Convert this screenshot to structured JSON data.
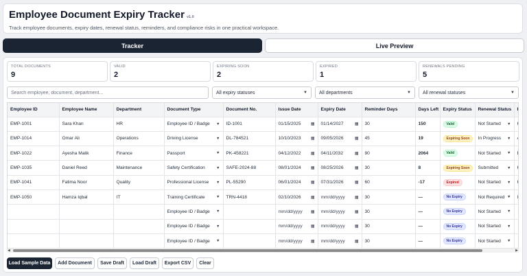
{
  "header": {
    "title": "Employee Document Expiry Tracker",
    "version": "v1.0",
    "subtitle": "Track employee documents, expiry dates, renewal status, reminders, and compliance risks in one practical workspace."
  },
  "tabs": [
    {
      "label": "Tracker",
      "active": true
    },
    {
      "label": "Live Preview",
      "active": false
    }
  ],
  "stats": [
    {
      "label": "TOTAL DOCUMENTS",
      "value": "9"
    },
    {
      "label": "VALID",
      "value": "2"
    },
    {
      "label": "EXPIRING SOON",
      "value": "2"
    },
    {
      "label": "EXPIRED",
      "value": "1"
    },
    {
      "label": "RENEWALS PENDING",
      "value": "5"
    }
  ],
  "filters": {
    "search_placeholder": "Search employee, document, department...",
    "expiry_status": "All expiry statuses",
    "departments": "All departments",
    "renewal_status": "All renewal statuses"
  },
  "table": {
    "columns": [
      "Employee ID",
      "Employee Name",
      "Department",
      "Document Type",
      "Document No.",
      "Issue Date",
      "Expiry Date",
      "Reminder Days",
      "Days Left",
      "Expiry Status",
      "Renewal Status",
      "R"
    ],
    "rows": [
      {
        "id": "EMP-1001",
        "name": "Sara Khan",
        "dept": "HR",
        "doc_type": "Employee ID / Badge",
        "doc_no": "ID-1001",
        "issue": "01/15/2025",
        "expiry": "01/14/2027",
        "reminder": "30",
        "days_left": "150",
        "status": "Valid",
        "renewal": "Not Started",
        "extra": "H"
      },
      {
        "id": "EMP-1014",
        "name": "Omar Ali",
        "dept": "Operations",
        "doc_type": "Driving License",
        "doc_no": "DL-784521",
        "issue": "10/10/2023",
        "expiry": "09/05/2026",
        "reminder": "45",
        "days_left": "19",
        "status": "Expiring Soon",
        "renewal": "In Progress",
        "extra": "A"
      },
      {
        "id": "EMP-1022",
        "name": "Ayesha Malik",
        "dept": "Finance",
        "doc_type": "Passport",
        "doc_no": "PK-458221",
        "issue": "04/12/2022",
        "expiry": "04/11/2032",
        "reminder": "90",
        "days_left": "2064",
        "status": "Valid",
        "renewal": "Not Started",
        "extra": "E"
      },
      {
        "id": "EMP-1035",
        "name": "Daniel Reed",
        "dept": "Maintenance",
        "doc_type": "Safety Certification",
        "doc_no": "SAFE-2024-88",
        "issue": "08/01/2024",
        "expiry": "08/25/2026",
        "reminder": "30",
        "days_left": "8",
        "status": "Expiring Soon",
        "renewal": "Submitted",
        "extra": "H"
      },
      {
        "id": "EMP-1041",
        "name": "Fatima Noor",
        "dept": "Quality",
        "doc_type": "Professional License",
        "doc_no": "PL-55290",
        "issue": "06/01/2024",
        "expiry": "07/31/2026",
        "reminder": "60",
        "days_left": "-17",
        "status": "Expired",
        "renewal": "Not Started",
        "extra": "H"
      },
      {
        "id": "EMP-1050",
        "name": "Hamza Iqbal",
        "dept": "IT",
        "doc_type": "Training Certificate",
        "doc_no": "TRN-4418",
        "issue": "02/10/2026",
        "expiry": "mm/dd/yyyy",
        "reminder": "30",
        "days_left": "—",
        "status": "No Expiry",
        "renewal": "Not Required",
        "extra": "IT"
      },
      {
        "id": "",
        "name": "",
        "dept": "",
        "doc_type": "Employee ID / Badge",
        "doc_no": "",
        "issue": "mm/dd/yyyy",
        "expiry": "mm/dd/yyyy",
        "reminder": "30",
        "days_left": "—",
        "status": "No Expiry",
        "renewal": "Not Started",
        "extra": ""
      },
      {
        "id": "",
        "name": "",
        "dept": "",
        "doc_type": "Employee ID / Badge",
        "doc_no": "",
        "issue": "mm/dd/yyyy",
        "expiry": "mm/dd/yyyy",
        "reminder": "30",
        "days_left": "—",
        "status": "No Expiry",
        "renewal": "Not Started",
        "extra": ""
      },
      {
        "id": "",
        "name": "",
        "dept": "",
        "doc_type": "Employee ID / Badge",
        "doc_no": "",
        "issue": "mm/dd/yyyy",
        "expiry": "mm/dd/yyyy",
        "reminder": "30",
        "days_left": "—",
        "status": "No Expiry",
        "renewal": "Not Started",
        "extra": ""
      }
    ]
  },
  "actions": [
    "Load Sample Data",
    "Add Document",
    "Save Draft",
    "Load Draft",
    "Export CSV",
    "Clear"
  ],
  "icons": {
    "calendar": "calendar-icon",
    "chevron": "chevron-down-icon"
  },
  "colors": {
    "primary": "#1b2433",
    "valid": "#166534",
    "expiring_soon": "#92400e",
    "expired": "#b91c1c",
    "no_expiry": "#3730a3"
  }
}
